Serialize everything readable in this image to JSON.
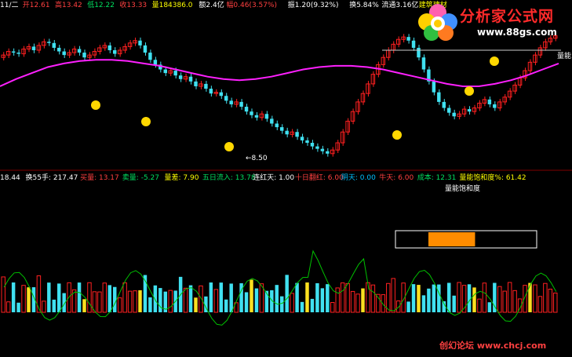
{
  "header": {
    "segments": [
      {
        "text": "11/二",
        "color": "#ffffff"
      },
      {
        "text": "开12.61",
        "color": "#ff4040"
      },
      {
        "text": "高13.42",
        "color": "#ff4040"
      },
      {
        "text": "低12.22",
        "color": "#00e060"
      },
      {
        "text": "收13.33",
        "color": "#ff4040"
      },
      {
        "text": "量184386.0",
        "color": "#ffff00"
      },
      {
        "text": "额2.4亿",
        "color": "#ffffff"
      },
      {
        "text": "幅0.46(3.57%)",
        "color": "#ff4040"
      },
      {
        "text": "振1.20(9.32%)",
        "color": "#ffffff"
      },
      {
        "text": "换5.84%",
        "color": "#ffffff"
      },
      {
        "text": "流通3.16亿",
        "color": "#ffffff"
      },
      {
        "text": "建筑建材",
        "color": "#ffff00"
      }
    ]
  },
  "price_panel": {
    "left_value": "18.44",
    "low_annotation": "←8.50",
    "right_label": "量能"
  },
  "indicator_panel": {
    "segments": [
      {
        "text": "18.44",
        "color": "#ffffff"
      },
      {
        "text": "换55手: 217.47",
        "color": "#ffffff"
      },
      {
        "text": "买量: 13.17",
        "color": "#ff4040"
      },
      {
        "text": "卖量: -5.27",
        "color": "#00e060"
      },
      {
        "text": "量差: 7.90",
        "color": "#ffff00"
      },
      {
        "text": "五日流入: 13.78",
        "color": "#00e060"
      },
      {
        "text": "连红天: 1.00",
        "color": "#ffffff"
      },
      {
        "text": "十日翻红: 6.00",
        "color": "#ff4040"
      },
      {
        "text": "阴天: 0.00",
        "color": "#00c0ff"
      },
      {
        "text": "牛天: 6.00",
        "color": "#ff4040"
      },
      {
        "text": "成本: 12.31",
        "color": "#00e060"
      },
      {
        "text": "量能饱和度%: 61.42",
        "color": "#ffff00"
      }
    ],
    "subtitle": "量能饱和度",
    "saturation_percent": 61.42
  },
  "brand": {
    "title": "分析家公式网",
    "url": "www.88gs.com"
  },
  "footer": {
    "text": "创幻论坛 www.chcj.com"
  },
  "colors": {
    "up": "#ff2020",
    "down": "#40e0f0",
    "ma": "#ff20ff",
    "volume_yellow": "#ffe020",
    "line": "#00c000",
    "saturation": "#ff8c00"
  },
  "chart_data": {
    "type": "candlestick",
    "price_range": [
      8.0,
      18.44
    ],
    "candles_close": [
      16.8,
      17.1,
      17.0,
      16.9,
      17.3,
      17.5,
      17.2,
      17.6,
      17.9,
      17.8,
      17.4,
      17.1,
      16.8,
      17.0,
      17.3,
      17.0,
      16.6,
      16.8,
      17.1,
      17.4,
      17.6,
      17.2,
      16.9,
      17.2,
      17.5,
      17.8,
      18.0,
      17.6,
      17.0,
      16.4,
      16.0,
      15.6,
      15.3,
      15.5,
      15.1,
      14.8,
      15.0,
      14.6,
      14.2,
      14.4,
      14.0,
      13.6,
      13.7,
      13.4,
      13.0,
      12.7,
      12.9,
      12.5,
      12.1,
      11.8,
      11.6,
      11.9,
      11.5,
      11.1,
      10.8,
      10.5,
      10.2,
      10.4,
      10.0,
      9.7,
      9.5,
      9.2,
      9.0,
      8.8,
      8.6,
      8.9,
      9.5,
      10.4,
      11.3,
      12.1,
      12.9,
      13.6,
      14.4,
      15.2,
      16.0,
      16.6,
      17.2,
      17.7,
      18.1,
      18.3,
      18.0,
      17.4,
      16.6,
      15.6,
      14.6,
      13.7,
      12.9,
      12.4,
      12.0,
      11.7,
      11.9,
      12.3,
      12.1,
      12.4,
      12.8,
      13.1,
      12.7,
      12.4,
      12.9,
      13.3,
      13.8,
      14.3,
      14.9,
      15.5,
      16.2,
      16.8,
      17.4,
      17.9,
      18.2,
      18.4
    ],
    "ma_values": [
      14.2,
      14.8,
      15.3,
      15.8,
      16.1,
      16.3,
      16.4,
      16.4,
      16.3,
      16.1,
      15.9,
      15.6,
      15.3,
      15.0,
      14.8,
      14.7,
      14.8,
      15.0,
      15.3,
      15.6,
      15.8,
      15.9,
      15.9,
      15.8,
      15.6,
      15.3,
      15.0,
      14.7,
      14.4,
      14.2,
      14.2,
      14.4,
      14.7,
      15.1,
      15.6,
      16.1
    ],
    "legend": [
      "量能饱和度%: 61.42"
    ]
  }
}
